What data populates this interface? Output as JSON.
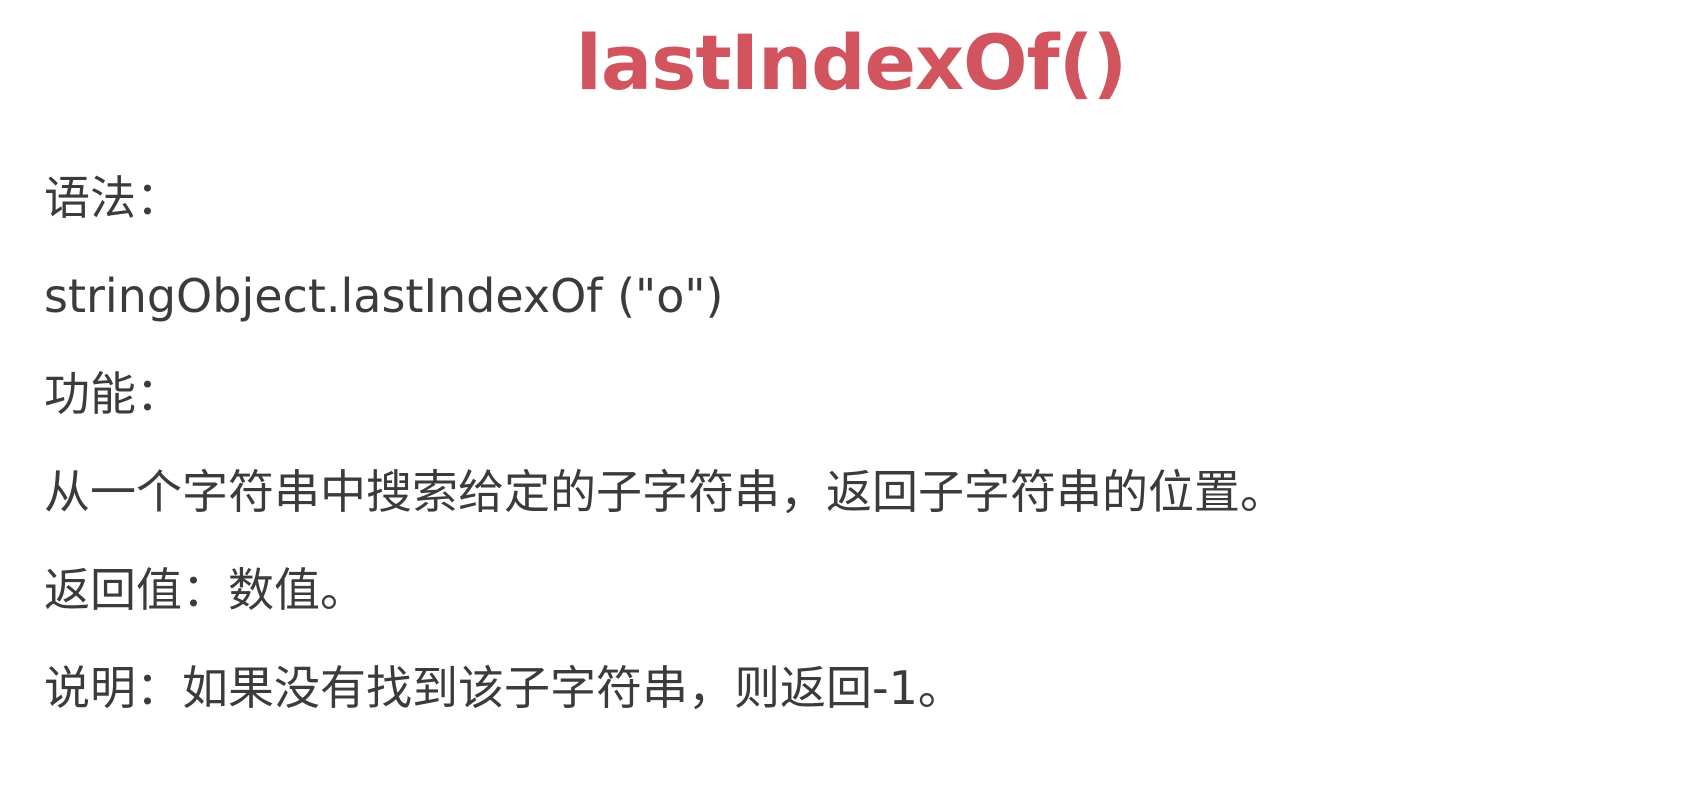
{
  "title": "lastIndexOf()",
  "lines": [
    "语法：",
    "stringObject.lastIndexOf (\"o\")",
    "功能：",
    "从一个字符串中搜索给定的子字符串，返回子字符串的位置。",
    "返回值：数值。",
    "说明：如果没有找到该子字符串，则返回-1。"
  ],
  "colors": {
    "title": "#d1545e",
    "text": "#3b3b3b",
    "background": "#ffffff"
  }
}
